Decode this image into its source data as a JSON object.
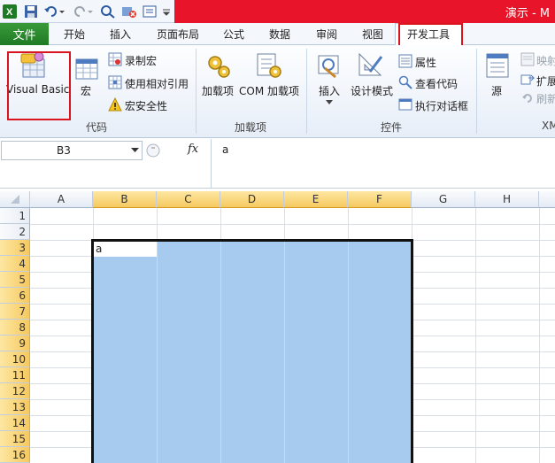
{
  "title_text": "演示 - M",
  "tabs": {
    "file": "文件",
    "home": "开始",
    "insert": "插入",
    "page_layout": "页面布局",
    "formulas": "公式",
    "data": "数据",
    "review": "审阅",
    "view": "视图",
    "developer": "开发工具"
  },
  "ribbon": {
    "code": {
      "visual_basic": "Visual Basic",
      "macros": "宏",
      "record_macro": "录制宏",
      "relative_refs": "使用相对引用",
      "macro_security": "宏安全性",
      "label": "代码"
    },
    "addins": {
      "addins": "加载项",
      "com_addins": "COM 加载项",
      "label": "加载项"
    },
    "controls": {
      "insert": "插入",
      "design_mode": "设计模式",
      "properties": "属性",
      "view_code": "查看代码",
      "run_dialog": "执行对话框",
      "label": "控件"
    },
    "xml": {
      "source": "源",
      "map_props": "映射",
      "expansion": "扩展",
      "refresh": "刷新",
      "label": "XM"
    }
  },
  "formula_bar": {
    "name_box": "B3",
    "fx_label": "fx",
    "formula": "a"
  },
  "grid": {
    "columns": [
      "A",
      "B",
      "C",
      "D",
      "E",
      "F",
      "G",
      "H"
    ],
    "selected_columns": [
      "B",
      "C",
      "D",
      "E",
      "F"
    ],
    "rows": [
      "1",
      "2",
      "3",
      "4",
      "5",
      "6",
      "7",
      "8",
      "9",
      "10",
      "11",
      "12",
      "13",
      "14",
      "15",
      "16"
    ],
    "selected_row_from": 3,
    "active_cell_value": "a"
  },
  "colors": {
    "file_tab": "#2a8a2f",
    "title_bar_red": "#e8152a",
    "selection_fill": "#a6cbef",
    "header_highlight": "#f6c960",
    "callout_red": "#d9141f"
  }
}
